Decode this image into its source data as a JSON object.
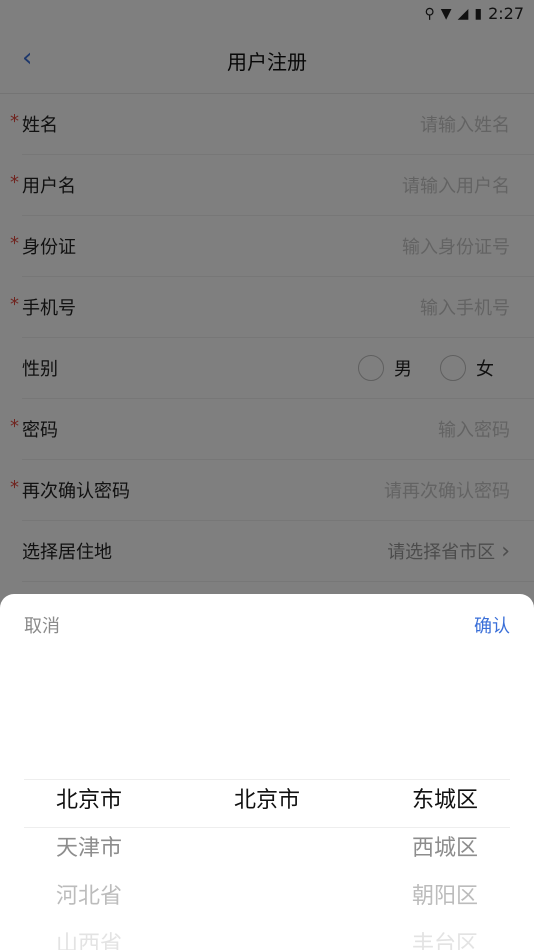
{
  "status_bar": {
    "time": "2:27"
  },
  "nav": {
    "title": "用户注册"
  },
  "form": {
    "fields": [
      {
        "label": "姓名",
        "placeholder": "请输入姓名",
        "required": true
      },
      {
        "label": "用户名",
        "placeholder": "请输入用户名",
        "required": true
      },
      {
        "label": "身份证",
        "placeholder": "输入身份证号",
        "required": true
      },
      {
        "label": "手机号",
        "placeholder": "输入手机号",
        "required": true
      },
      {
        "label": "性别",
        "options": [
          "男",
          "女"
        ],
        "required": false
      },
      {
        "label": "密码",
        "placeholder": "输入密码",
        "required": true
      },
      {
        "label": "再次确认密码",
        "placeholder": "请再次确认密码",
        "required": true
      },
      {
        "label": "选择居住地",
        "placeholder": "请选择省市区",
        "required": false
      }
    ],
    "required_mark": "*"
  },
  "picker": {
    "cancel_label": "取消",
    "confirm_label": "确认",
    "province": [
      "北京市",
      "天津市",
      "河北省",
      "山西省"
    ],
    "city": [
      "北京市"
    ],
    "district": [
      "东城区",
      "西城区",
      "朝阳区",
      "丰台区"
    ]
  },
  "colors": {
    "accent": "#3a6fd8",
    "required": "#e0483f"
  }
}
